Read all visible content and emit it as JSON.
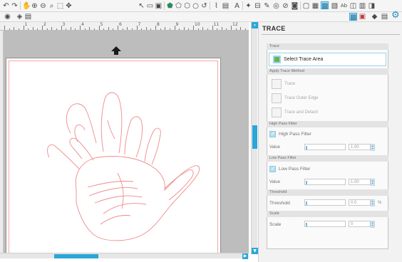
{
  "toolbar": {
    "left_icons": [
      "undo-icon",
      "redo-icon",
      "pan-hand-icon",
      "zoom-in-icon",
      "zoom-out-icon",
      "zoom-select-icon",
      "fit-page-icon",
      "drag-icon"
    ],
    "right_icons": [
      "select-icon",
      "draw-rect-icon",
      "draw-image-icon",
      "polygon-icon",
      "shape-icon",
      "pentagon-icon",
      "circle-icon",
      "arc-icon",
      "line-chart-icon",
      "bar-chart-icon",
      "text-icon",
      "node-edit-icon",
      "knife-icon",
      "eraser-icon",
      "weld-icon",
      "image-trace-icon",
      "grid-icon",
      "page-icon",
      "trace-icon",
      "send-icon",
      "ab-text-icon",
      "layers-icon",
      "cut-settings-icon",
      "library-icon",
      "store-icon"
    ]
  },
  "toolbar2": {
    "left_icons": [
      "grid-toggle-icon",
      "point-icon",
      "page-layout-icon"
    ],
    "right_icons": [
      "trace-panel-icon",
      "store-panel-icon",
      "eraser-panel-icon",
      "replicate-panel-icon",
      "settings-gear-icon"
    ]
  },
  "ruler": {
    "numbers": [
      "1",
      "2",
      "3",
      "4",
      "5",
      "6",
      "7",
      "8",
      "9",
      "10",
      "11",
      "12"
    ]
  },
  "panel": {
    "title": "TRACE",
    "trace_section": "Trace",
    "select_label": "Select Trace Area",
    "apply_section": "Apply Trace Method",
    "methods": [
      {
        "name": "trace-method",
        "label": "Trace"
      },
      {
        "name": "trace-outer-edge-method",
        "label": "Trace Outer Edge"
      },
      {
        "name": "trace-and-detach-method",
        "label": "Trace and Detach"
      }
    ],
    "high_pass_section": "High Pass Filter",
    "high_pass_label": "High Pass Filter",
    "high_pass_value_label": "Value",
    "high_pass_value": "1.00",
    "low_pass_section": "Low Pass Filter",
    "low_pass_label": "Low Pass Filter",
    "low_pass_value_label": "Value",
    "low_pass_value": "1.00",
    "threshold_section": "Threshold",
    "threshold_label": "Threshold",
    "threshold_value": "0.0",
    "threshold_unit": "%",
    "scale_section": "Scale",
    "scale_label": "Scale",
    "scale_value": "0"
  },
  "colors": {
    "accent": "#2ba6d6",
    "trace_line": "#f08a8a",
    "canvas_bg": "#bdbdbd"
  }
}
